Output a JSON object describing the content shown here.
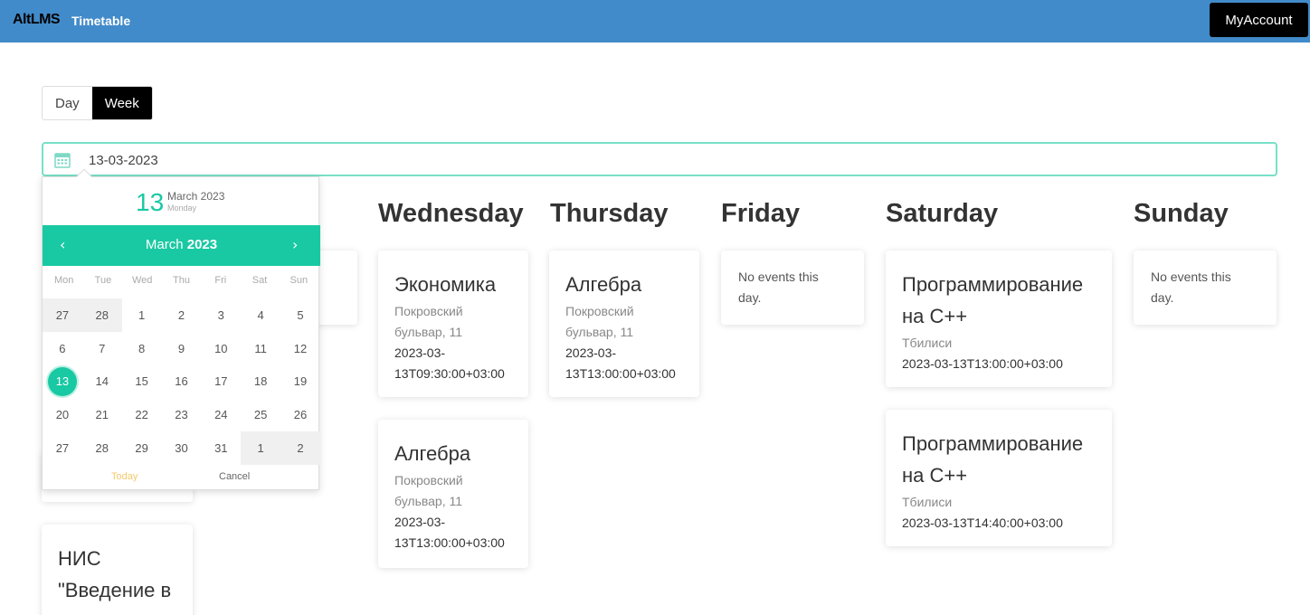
{
  "app": {
    "logo": "AltLMS",
    "title": "Timetable",
    "account_label": "MyAccount"
  },
  "view_toggle": {
    "day_label": "Day",
    "week_label": "Week",
    "active": "Week"
  },
  "date_field": {
    "value": "13-03-2023",
    "icon": "calendar-icon"
  },
  "days": {
    "wednesday": "Wednesday",
    "thursday": "Thursday",
    "friday": "Friday",
    "saturday": "Saturday",
    "sunday": "Sunday"
  },
  "events": {
    "monday_partial": {
      "title_line1": "НИС",
      "title_line2": "\"Введение в"
    },
    "wed_1": {
      "title": "Экономика",
      "loc_line1": "Покровский",
      "loc_line2": "бульвар, 11",
      "time_line1": "2023-03-",
      "time_line2": "13T09:30:00+03:00"
    },
    "wed_2": {
      "title": "Алгебра",
      "loc_line1": "Покровский",
      "loc_line2": "бульвар, 11",
      "time_line1": "2023-03-",
      "time_line2": "13T13:00:00+03:00"
    },
    "thu_1": {
      "title": "Алгебра",
      "loc_line1": "Покровский",
      "loc_line2": "бульвар, 11",
      "time_line1": "2023-03-",
      "time_line2": "13T13:00:00+03:00"
    },
    "fri_empty": {
      "line1": "No events this",
      "line2": "day."
    },
    "sat_1": {
      "title_line1": "Программирование",
      "title_line2": "на C++",
      "loc": "Тбилиси",
      "time": "2023-03-13T13:00:00+03:00"
    },
    "sat_2": {
      "title_line1": "Программирование",
      "title_line2": "на C++",
      "loc": "Тбилиси",
      "time": "2023-03-13T14:40:00+03:00"
    },
    "sun_empty": {
      "line1": "No events this",
      "line2": "day."
    }
  },
  "datepicker": {
    "selected_day": "13",
    "selected_month": "March 2023",
    "selected_weekday": "Monday",
    "header_month": "March",
    "header_year": "2023",
    "prev": "‹",
    "next": "›",
    "weekdays": [
      "Mon",
      "Tue",
      "Wed",
      "Thu",
      "Fri",
      "Sat",
      "Sun"
    ],
    "weeks": [
      [
        "27",
        "28",
        "1",
        "2",
        "3",
        "4",
        "5"
      ],
      [
        "6",
        "7",
        "8",
        "9",
        "10",
        "11",
        "12"
      ],
      [
        "13",
        "14",
        "15",
        "16",
        "17",
        "18",
        "19"
      ],
      [
        "20",
        "21",
        "22",
        "23",
        "24",
        "25",
        "26"
      ],
      [
        "27",
        "28",
        "29",
        "30",
        "31",
        "1",
        "2"
      ]
    ],
    "today_label": "Today",
    "cancel_label": "Cancel"
  },
  "colors": {
    "topbar": "#428bca",
    "accent": "#19c9a3",
    "input_border": "#78e0c8"
  }
}
